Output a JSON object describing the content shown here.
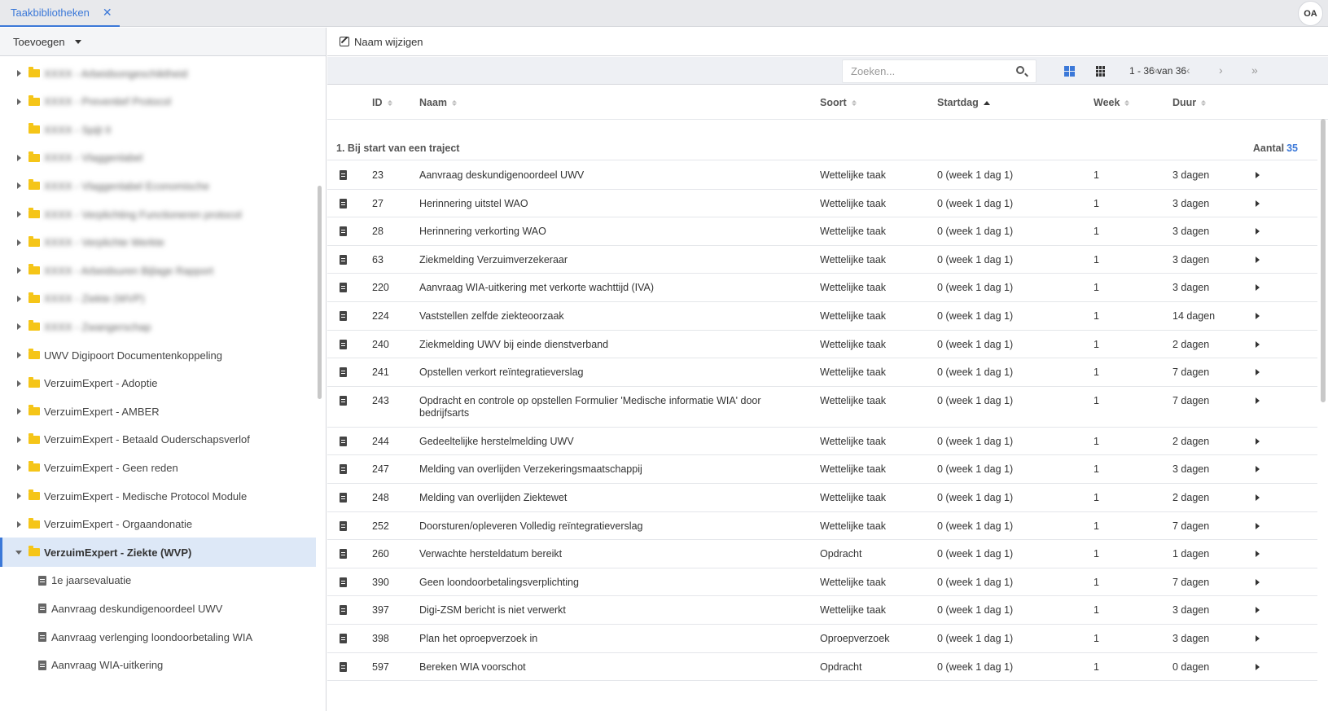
{
  "tabs": [
    {
      "label": "Taakbibliotheken",
      "close": "✕"
    }
  ],
  "user": {
    "initials": "OA"
  },
  "left_toolbar": {
    "add_label": "Toevoegen"
  },
  "tree": {
    "blurred_items": [
      "XXXX - Arbeidsongeschiktheid",
      "XXXX - Preventief Protocol",
      "XXXX - Spijt II",
      "XXXX - Vlaggenlabel",
      "XXXX - Vlaggenlabel Economische",
      "XXXX - Verplichting Functioneren protocol",
      "XXXX - Verplichte Werkte",
      "XXXX - Arbeidsuren Bijlage Rapport",
      "XXXX - Ziekte (WVP)",
      "XXXX - Zwangerschap"
    ],
    "items": [
      "UWV Digipoort Documentenkoppeling",
      "VerzuimExpert - Adoptie",
      "VerzuimExpert - AMBER",
      "VerzuimExpert - Betaald Ouderschapsverlof",
      "VerzuimExpert - Geen reden",
      "VerzuimExpert - Medische Protocol Module",
      "VerzuimExpert - Orgaandonatie"
    ],
    "selected": "VerzuimExpert - Ziekte (WVP)",
    "children": [
      "1e jaarsevaluatie",
      "Aanvraag deskundigenoordeel UWV",
      "Aanvraag verlenging loondoorbetaling WIA",
      "Aanvraag WIA-uitkering"
    ]
  },
  "right_toolbar": {
    "rename_label": "Naam wijzigen"
  },
  "search": {
    "placeholder": "Zoeken..."
  },
  "pager": {
    "text": "1 - 36 van 36",
    "first": "«",
    "prev": "‹",
    "next": "›",
    "last": "»"
  },
  "columns": {
    "id": "ID",
    "name": "Naam",
    "type": "Soort",
    "start": "Startdag",
    "week": "Week",
    "duration": "Duur"
  },
  "group": {
    "title": "1. Bij start van een traject",
    "count_label": "Aantal",
    "count": "35"
  },
  "rows": [
    {
      "id": "23",
      "name": "Aanvraag deskundigenoordeel UWV",
      "type": "Wettelijke taak",
      "start": "0 (week 1 dag 1)",
      "week": "1",
      "duration": "3 dagen"
    },
    {
      "id": "27",
      "name": "Herinnering uitstel WAO",
      "type": "Wettelijke taak",
      "start": "0 (week 1 dag 1)",
      "week": "1",
      "duration": "3 dagen"
    },
    {
      "id": "28",
      "name": "Herinnering verkorting WAO",
      "type": "Wettelijke taak",
      "start": "0 (week 1 dag 1)",
      "week": "1",
      "duration": "3 dagen"
    },
    {
      "id": "63",
      "name": "Ziekmelding Verzuimverzekeraar",
      "type": "Wettelijke taak",
      "start": "0 (week 1 dag 1)",
      "week": "1",
      "duration": "3 dagen"
    },
    {
      "id": "220",
      "name": "Aanvraag WIA-uitkering met verkorte wachttijd (IVA)",
      "type": "Wettelijke taak",
      "start": "0 (week 1 dag 1)",
      "week": "1",
      "duration": "3 dagen"
    },
    {
      "id": "224",
      "name": "Vaststellen zelfde ziekteoorzaak",
      "type": "Wettelijke taak",
      "start": "0 (week 1 dag 1)",
      "week": "1",
      "duration": "14 dagen"
    },
    {
      "id": "240",
      "name": "Ziekmelding UWV bij einde dienstverband",
      "type": "Wettelijke taak",
      "start": "0 (week 1 dag 1)",
      "week": "1",
      "duration": "2 dagen"
    },
    {
      "id": "241",
      "name": "Opstellen verkort reïntegratieverslag",
      "type": "Wettelijke taak",
      "start": "0 (week 1 dag 1)",
      "week": "1",
      "duration": "7 dagen"
    },
    {
      "id": "243",
      "name": "Opdracht en controle op opstellen Formulier 'Medische informatie WIA' door",
      "name2": "bedrijfsarts",
      "type": "Wettelijke taak",
      "start": "0 (week 1 dag 1)",
      "week": "1",
      "duration": "7 dagen"
    },
    {
      "id": "244",
      "name": "Gedeeltelijke herstelmelding UWV",
      "type": "Wettelijke taak",
      "start": "0 (week 1 dag 1)",
      "week": "1",
      "duration": "2 dagen"
    },
    {
      "id": "247",
      "name": "Melding van overlijden Verzekeringsmaatschappij",
      "type": "Wettelijke taak",
      "start": "0 (week 1 dag 1)",
      "week": "1",
      "duration": "3 dagen"
    },
    {
      "id": "248",
      "name": "Melding van overlijden Ziektewet",
      "type": "Wettelijke taak",
      "start": "0 (week 1 dag 1)",
      "week": "1",
      "duration": "2 dagen"
    },
    {
      "id": "252",
      "name": "Doorsturen/opleveren Volledig reïntegratieverslag",
      "type": "Wettelijke taak",
      "start": "0 (week 1 dag 1)",
      "week": "1",
      "duration": "7 dagen"
    },
    {
      "id": "260",
      "name": "Verwachte hersteldatum bereikt",
      "type": "Opdracht",
      "start": "0 (week 1 dag 1)",
      "week": "1",
      "duration": "1 dagen"
    },
    {
      "id": "390",
      "name": "Geen loondoorbetalingsverplichting",
      "type": "Wettelijke taak",
      "start": "0 (week 1 dag 1)",
      "week": "1",
      "duration": "7 dagen"
    },
    {
      "id": "397",
      "name": "Digi-ZSM bericht is niet verwerkt",
      "type": "Wettelijke taak",
      "start": "0 (week 1 dag 1)",
      "week": "1",
      "duration": "3 dagen"
    },
    {
      "id": "398",
      "name": "Plan het oproepverzoek in",
      "type": "Oproepverzoek",
      "start": "0 (week 1 dag 1)",
      "week": "1",
      "duration": "3 dagen"
    },
    {
      "id": "597",
      "name": "Bereken WIA voorschot",
      "type": "Opdracht",
      "start": "0 (week 1 dag 1)",
      "week": "1",
      "duration": "0 dagen"
    }
  ],
  "icons": {
    "tab_close": "close-icon",
    "folder": "folder-icon",
    "task": "clipboard-icon",
    "search": "search-icon",
    "edit": "edit-icon"
  },
  "colors": {
    "accent": "#3b78d8",
    "folder": "#f5c518",
    "selected_bg": "#dde8f7"
  }
}
